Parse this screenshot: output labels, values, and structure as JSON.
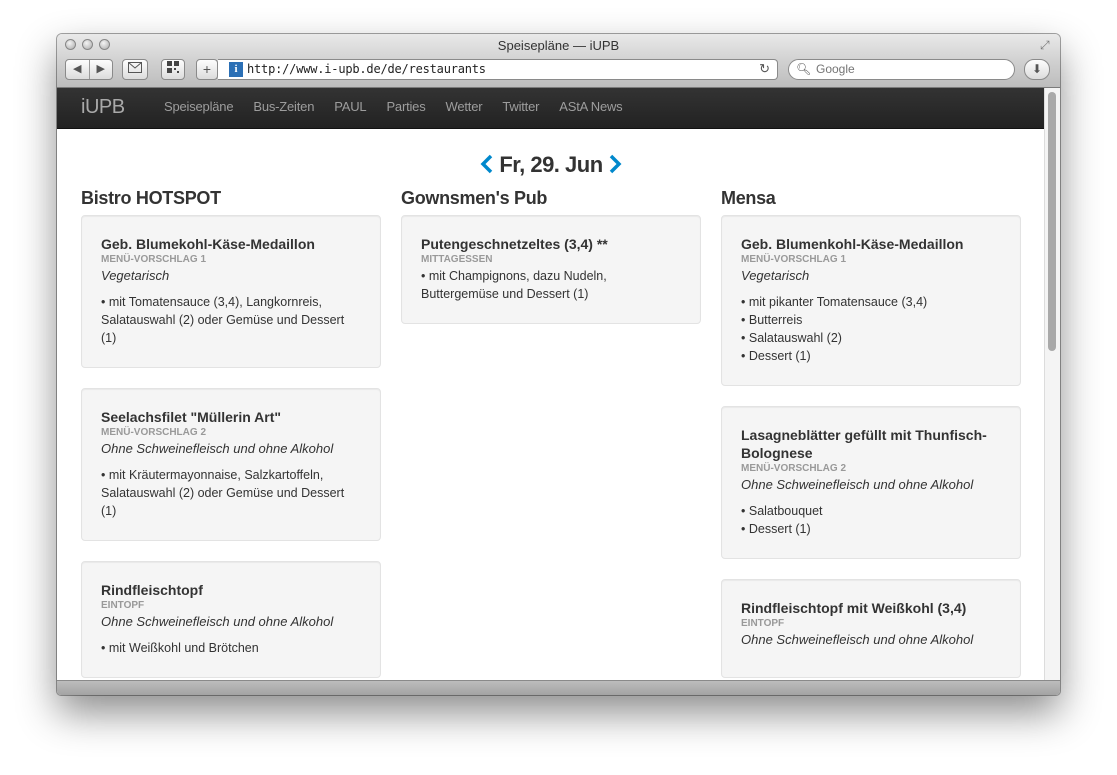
{
  "window": {
    "title": "Speisepläne — iUPB"
  },
  "toolbar": {
    "url": "http://www.i-upb.de/de/restaurants",
    "search_placeholder": "Google",
    "add_label": "+"
  },
  "navbar": {
    "brand": "iUPB",
    "links": [
      "Speisepläne",
      "Bus-Zeiten",
      "PAUL",
      "Parties",
      "Wetter",
      "Twitter",
      "AStA News"
    ]
  },
  "date": "Fr, 29. Jun",
  "colors": {
    "accent": "#0088cc",
    "navbar": "#222222",
    "card": "#f5f5f5"
  },
  "columns": [
    {
      "name": "Bistro HOTSPOT",
      "dishes": [
        {
          "title": "Geb. Blumekohl-Käse-Medaillon",
          "category": "MENÜ-VORSCHLAG 1",
          "note": "Vegetarisch",
          "items": [
            "mit Tomatensauce (3,4), Langkornreis, Salatauswahl (2) oder Gemüse und Dessert (1)"
          ]
        },
        {
          "title": "Seelachsfilet \"Müllerin Art\"",
          "category": "MENÜ-VORSCHLAG 2",
          "note": "Ohne Schweinefleisch und ohne Alkohol",
          "items": [
            "mit Kräutermayonnaise, Salzkartoffeln, Salatauswahl (2) oder Gemüse und Dessert (1)"
          ]
        },
        {
          "title": "Rindfleischtopf",
          "category": "EINTOPF",
          "note": "Ohne Schweinefleisch und ohne Alkohol",
          "items": [
            "mit Weißkohl und Brötchen"
          ]
        }
      ]
    },
    {
      "name": "Gownsmen's Pub",
      "dishes": [
        {
          "title": "Putengeschnetzeltes (3,4) **",
          "category": "MITTAGESSEN",
          "note": "",
          "items": [
            "mit Champignons, dazu Nudeln, Buttergemüse und Dessert (1)"
          ]
        }
      ]
    },
    {
      "name": "Mensa",
      "dishes": [
        {
          "title": "Geb. Blumenkohl-Käse-Medaillon",
          "category": "MENÜ-VORSCHLAG 1",
          "note": "Vegetarisch",
          "items": [
            "mit pikanter Tomatensauce (3,4)",
            "Butterreis",
            "Salatauswahl (2)",
            "Dessert (1)"
          ]
        },
        {
          "title": "Lasagneblätter gefüllt mit Thunfisch-Bolognese",
          "category": "MENÜ-VORSCHLAG 2",
          "note": "Ohne Schweinefleisch und ohne Alkohol",
          "items": [
            "Salatbouquet",
            "Dessert (1)"
          ]
        },
        {
          "title": "Rindfleischtopf mit Weißkohl (3,4)",
          "category": "EINTOPF",
          "note": "Ohne Schweinefleisch und ohne Alkohol",
          "items": []
        }
      ]
    }
  ]
}
